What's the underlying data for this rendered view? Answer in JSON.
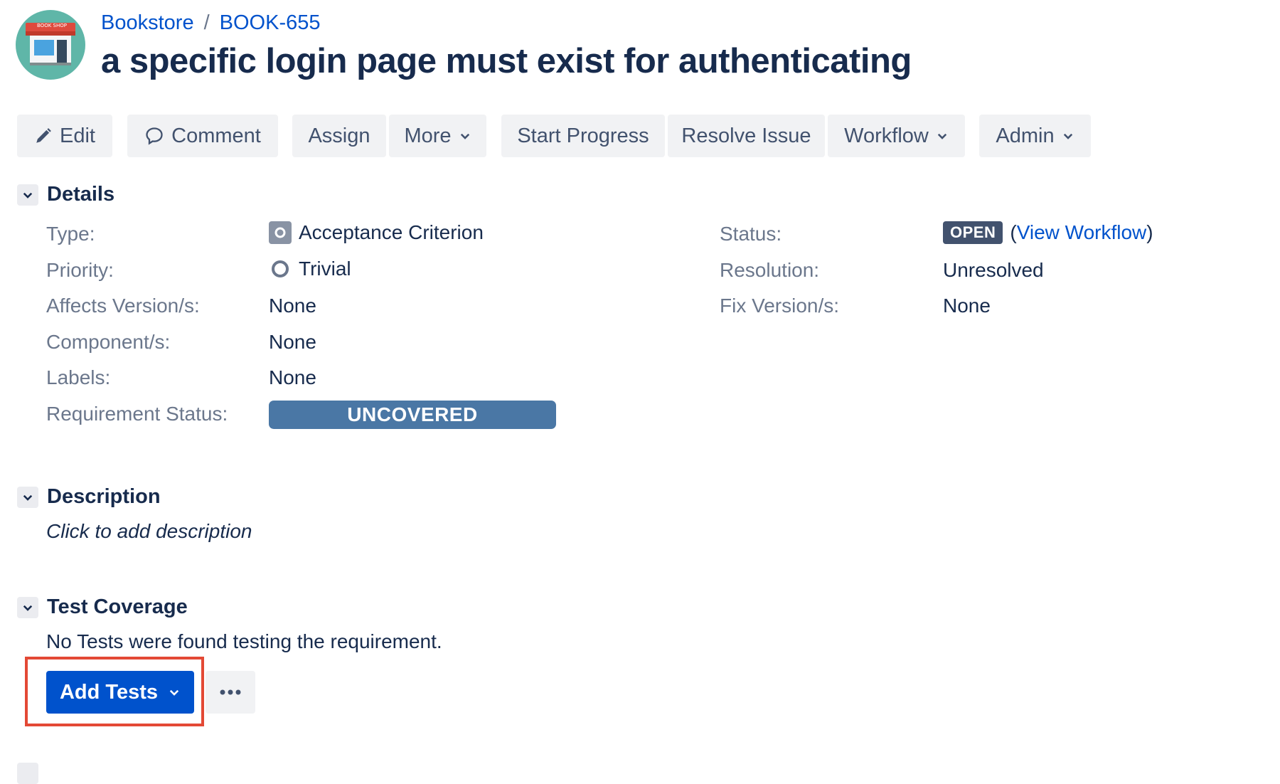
{
  "header": {
    "project": "Bookstore",
    "separator": "/",
    "issue_key": "BOOK-655",
    "title": "a specific login page must exist for authenticating",
    "avatar_sign": "BOOK SHOP"
  },
  "toolbar": {
    "edit": "Edit",
    "comment": "Comment",
    "assign": "Assign",
    "more": "More",
    "start_progress": "Start Progress",
    "resolve_issue": "Resolve Issue",
    "workflow": "Workflow",
    "admin": "Admin"
  },
  "details": {
    "title": "Details",
    "type_label": "Type:",
    "type_value": "Acceptance Criterion",
    "priority_label": "Priority:",
    "priority_value": "Trivial",
    "affects_label": "Affects Version/s:",
    "affects_value": "None",
    "component_label": "Component/s:",
    "component_value": "None",
    "labels_label": "Labels:",
    "labels_value": "None",
    "req_status_label": "Requirement Status:",
    "req_status_value": "UNCOVERED",
    "status_label": "Status:",
    "status_value": "OPEN",
    "view_workflow_open": "(",
    "view_workflow": "View Workflow",
    "view_workflow_close": ")",
    "resolution_label": "Resolution:",
    "resolution_value": "Unresolved",
    "fix_label": "Fix Version/s:",
    "fix_value": "None"
  },
  "description": {
    "title": "Description",
    "placeholder": "Click to add description"
  },
  "test_coverage": {
    "title": "Test Coverage",
    "message": "No Tests were found testing the requirement.",
    "add_tests": "Add Tests"
  },
  "colors": {
    "primary": "#0052cc",
    "req_status": "#4a77a5",
    "status_lozenge": "#42526e",
    "highlight": "#e34935"
  }
}
